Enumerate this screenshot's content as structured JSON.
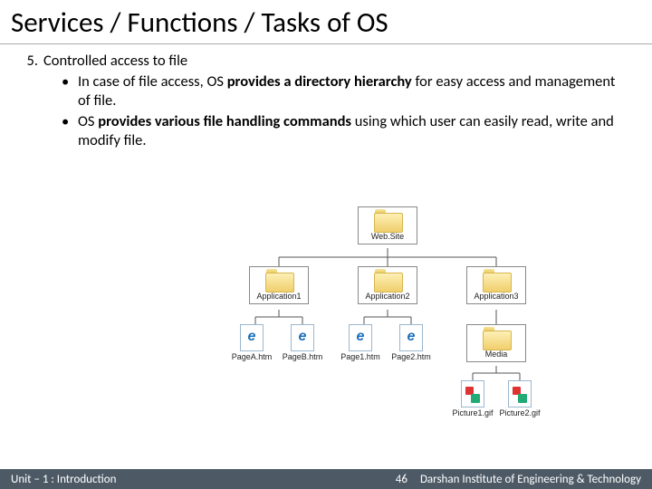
{
  "title": "Services / Functions / Tasks of OS",
  "list": {
    "number": "5.",
    "heading": "Controlled access to file",
    "bullets": [
      {
        "pre": "In case of file access, OS ",
        "bold": "provides a directory hierarchy",
        "post": " for easy access and management of file."
      },
      {
        "pre": "OS ",
        "bold": "provides various file handling commands",
        "post": " using which user can easily read, write and modify file."
      }
    ]
  },
  "diagram": {
    "root": "Web.Site",
    "apps": [
      "Application1",
      "Application2",
      "Application3"
    ],
    "pagesA": [
      "PageA.htm",
      "PageB.htm"
    ],
    "pagesB": [
      "Page1.htm",
      "Page2.htm"
    ],
    "media": "Media",
    "pics": [
      "Picture1.gif",
      "Picture2.gif"
    ]
  },
  "footer": {
    "unit": "Unit – 1 : Introduction",
    "page": "46",
    "inst": "Darshan Institute of Engineering & Technology"
  }
}
